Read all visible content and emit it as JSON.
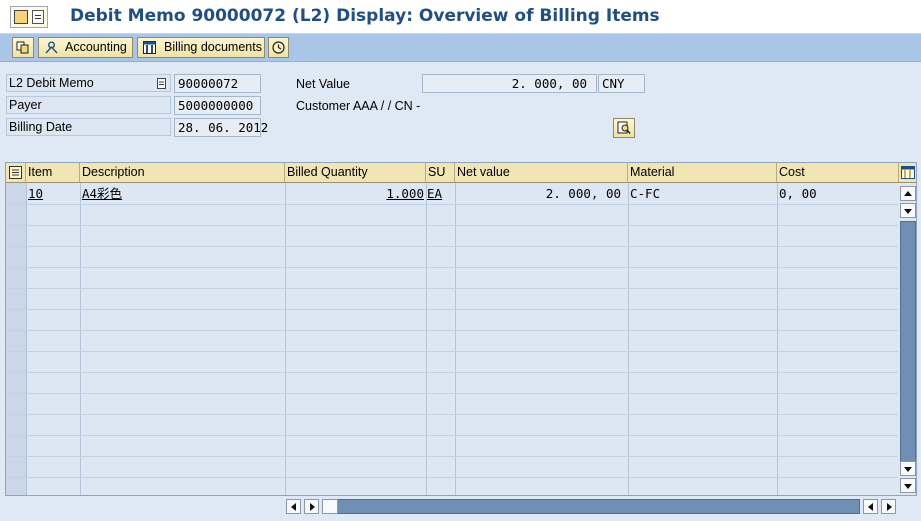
{
  "header": {
    "title": "Debit Memo 90000072   (L2) Display: Overview of Billing Items"
  },
  "toolbar": {
    "accounting_label": "Accounting",
    "billing_documents_label": "Billing documents"
  },
  "doc": {
    "type_label": "L2 Debit Memo",
    "number": "90000072",
    "payer_label": "Payer",
    "payer": "5000000000",
    "billing_date_label": "Billing Date",
    "billing_date": "28. 06. 2012",
    "net_value_label": "Net Value",
    "net_value": "2. 000, 00",
    "currency": "CNY",
    "customer": "Customer AAA /  / CN -"
  },
  "table": {
    "columns": [
      "Item",
      "Description",
      "Billed Quantity",
      "SU",
      "Net value",
      "Material",
      "Cost"
    ],
    "rows": [
      {
        "item": "10",
        "description": "A4彩色",
        "billed_quantity": "1.000",
        "su": "EA",
        "net_value": "2. 000, 00",
        "material": "C-FC",
        "cost": "0, 00"
      }
    ]
  },
  "icons": {
    "title_menu": "menu-icon",
    "toolbar": [
      "display-document-flow-icon",
      "accounting-icon",
      "billing-documents-icon",
      "status-icon"
    ],
    "header_detail": "header-details-icon",
    "table_select_all": "select-all-icon",
    "table_settings": "table-configuration-icon"
  },
  "colors": {
    "title": "#1f4f86",
    "toolbar": "#a9c6e8",
    "background": "#dfe9f5",
    "column_header": "#f1e5b4",
    "scroll_thumb": "#6f90b4"
  }
}
